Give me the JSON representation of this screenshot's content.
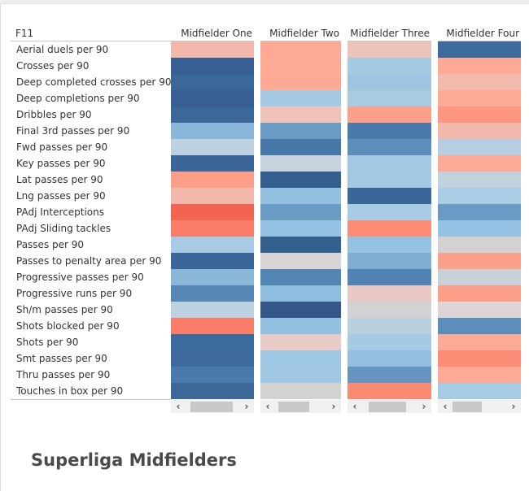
{
  "title": "Superliga Midfielders",
  "chart_data": {
    "type": "heatmap",
    "title": "Superliga Midfielders",
    "row_dimension_label": "F11",
    "columns": [
      "Midfielder One",
      "Midfielder Two",
      "Midfielder Three",
      "Midfielder Four"
    ],
    "rows": [
      "Aerial duels per 90",
      "Crosses per 90",
      "Deep completed crosses per 90",
      "Deep completions per 90",
      "Dribbles per 90",
      "Final 3rd passes per 90",
      "Fwd passes per 90",
      "Key passes per 90",
      "Lat passes per 90",
      "Lng passes per 90",
      "PAdj Interceptions",
      "PAdj Sliding tackles",
      "Passes per 90",
      "Passes to penalty area per 90",
      "Progressive passes per 90",
      "Progressive runs per 90",
      "Sh/m passes per 90",
      "Shots blocked per 90",
      "Shots per 90",
      "Smt passes per 90",
      "Thru passes per 90",
      "Touches in box per 90"
    ],
    "color_scale": {
      "type": "diverging",
      "low_color": "#2f5a8c",
      "mid_color": "#d4d4d4",
      "high_color": "#f26450",
      "domain": [
        -1,
        1
      ]
    },
    "values": [
      [
        0.4,
        0.55,
        0.3,
        -0.9
      ],
      [
        -0.9,
        0.55,
        -0.45,
        0.55
      ],
      [
        -0.85,
        0.55,
        -0.5,
        0.4
      ],
      [
        -0.9,
        -0.45,
        -0.45,
        0.55
      ],
      [
        -0.85,
        0.35,
        0.6,
        0.7
      ],
      [
        -0.55,
        -0.65,
        -0.8,
        0.4
      ],
      [
        -0.25,
        -0.8,
        -0.7,
        -0.3
      ],
      [
        -0.9,
        -0.15,
        -0.45,
        0.55
      ],
      [
        0.6,
        -0.95,
        -0.45,
        -0.15
      ],
      [
        0.4,
        -0.5,
        -0.9,
        -0.4
      ],
      [
        0.95,
        -0.65,
        -0.4,
        -0.65
      ],
      [
        0.8,
        -0.5,
        0.75,
        -0.5
      ],
      [
        -0.4,
        -0.95,
        -0.5,
        0.0
      ],
      [
        -0.9,
        0.05,
        -0.6,
        0.6
      ],
      [
        -0.55,
        -0.75,
        -0.8,
        -0.1
      ],
      [
        -0.7,
        -0.5,
        0.3,
        0.65
      ],
      [
        -0.25,
        -1.0,
        0.0,
        0.1
      ],
      [
        0.8,
        -0.5,
        -0.25,
        -0.7
      ],
      [
        -0.85,
        0.25,
        -0.4,
        0.55
      ],
      [
        -0.85,
        -0.45,
        -0.55,
        0.75
      ],
      [
        -0.8,
        -0.45,
        -0.7,
        0.55
      ],
      [
        -0.9,
        0.0,
        0.75,
        -0.4
      ]
    ],
    "cell_colors": [
      [
        "#f3b8ac",
        "#fcaa96",
        "#ebc4bc",
        "#3d6a9c"
      ],
      [
        "#375f94",
        "#fcaa96",
        "#a5cae4",
        "#fcaa96"
      ],
      [
        "#3b6799",
        "#fcaa96",
        "#9dc5e2",
        "#f2b9ad"
      ],
      [
        "#375f94",
        "#a5cae4",
        "#a8cbe0",
        "#fcaa96"
      ],
      [
        "#3b6799",
        "#efc3ba",
        "#fca08c",
        "#fc9681"
      ],
      [
        "#8ab7da",
        "#6a9bc4",
        "#4a7aab",
        "#f3b8ac"
      ],
      [
        "#bdd2e0",
        "#4878a8",
        "#5c8ebb",
        "#b7cde1"
      ],
      [
        "#3a6699",
        "#c6d2dc",
        "#a3c8e3",
        "#fcaa96"
      ],
      [
        "#fc9e88",
        "#345e8e",
        "#a3c8e3",
        "#c2d2dd"
      ],
      [
        "#f3b8ac",
        "#93bfe0",
        "#3a6699",
        "#a8cde5"
      ],
      [
        "#f26452",
        "#6a9bc4",
        "#a8cbe6",
        "#6a9bc4"
      ],
      [
        "#f97c68",
        "#95c1e2",
        "#fc8c74",
        "#95c1e2"
      ],
      [
        "#a7cbe5",
        "#325f8e",
        "#95c1e2",
        "#d2d2d2"
      ],
      [
        "#3a6699",
        "#d8d4d4",
        "#7eaed3",
        "#fca08c"
      ],
      [
        "#89b6d9",
        "#5386b2",
        "#5184b4",
        "#c8d0d8"
      ],
      [
        "#5687b4",
        "#8ebde0",
        "#e9c8c4",
        "#fc9e88"
      ],
      [
        "#bdd2e0",
        "#345788",
        "#d2d2d2",
        "#ddd5d5"
      ],
      [
        "#f97c68",
        "#94c0e2",
        "#bbd0de",
        "#5c8ebb"
      ],
      [
        "#3b6b9e",
        "#e8cbc7",
        "#a5cae4",
        "#fcaa96"
      ],
      [
        "#3d6a9c",
        "#a0c8e5",
        "#93bee0",
        "#fc8c76"
      ],
      [
        "#4a7aab",
        "#a0c8e5",
        "#6594c0",
        "#fcaa96"
      ],
      [
        "#3b6799",
        "#d2d2d2",
        "#fc8a70",
        "#a7cbe5"
      ]
    ]
  },
  "scrollbars": [
    {
      "left_icon": "chevron-left",
      "right_icon": "chevron-right"
    },
    {
      "left_icon": "chevron-left",
      "right_icon": "chevron-right"
    },
    {
      "left_icon": "chevron-left",
      "right_icon": "chevron-right"
    },
    {
      "left_icon": "chevron-left",
      "right_icon": "chevron-right"
    }
  ],
  "glyphs": {
    "left": "‹",
    "right": "›"
  }
}
